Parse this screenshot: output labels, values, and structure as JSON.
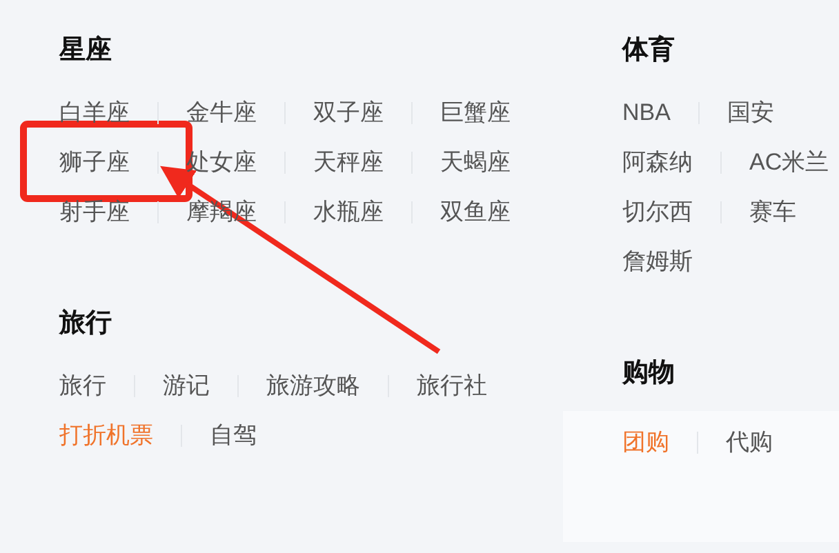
{
  "left_column": [
    {
      "title": "星座",
      "panel": false,
      "rows": [
        [
          {
            "text": "白羊座",
            "highlighted": false
          },
          {
            "text": "金牛座",
            "highlighted": false
          },
          {
            "text": "双子座",
            "highlighted": false
          },
          {
            "text": "巨蟹座",
            "highlighted": false
          }
        ],
        [
          {
            "text": "狮子座",
            "highlighted": false
          },
          {
            "text": "处女座",
            "highlighted": false
          },
          {
            "text": "天秤座",
            "highlighted": false
          },
          {
            "text": "天蝎座",
            "highlighted": false
          }
        ],
        [
          {
            "text": "射手座",
            "highlighted": false
          },
          {
            "text": "摩羯座",
            "highlighted": false
          },
          {
            "text": "水瓶座",
            "highlighted": false
          },
          {
            "text": "双鱼座",
            "highlighted": false
          }
        ]
      ]
    },
    {
      "title": "旅行",
      "panel": false,
      "rows": [
        [
          {
            "text": "旅行",
            "highlighted": false
          },
          {
            "text": "游记",
            "highlighted": false
          },
          {
            "text": "旅游攻略",
            "highlighted": false
          },
          {
            "text": "旅行社",
            "highlighted": false
          }
        ],
        [
          {
            "text": "打折机票",
            "highlighted": true
          },
          {
            "text": "自驾",
            "highlighted": false
          }
        ]
      ]
    }
  ],
  "right_column": [
    {
      "title": "体育",
      "panel": false,
      "rows": [
        [
          {
            "text": "NBA",
            "highlighted": false
          },
          {
            "text": "国安",
            "highlighted": false
          }
        ],
        [
          {
            "text": "阿森纳",
            "highlighted": false
          },
          {
            "text": "AC米兰",
            "highlighted": false
          }
        ],
        [
          {
            "text": "切尔西",
            "highlighted": false
          },
          {
            "text": "赛车",
            "highlighted": false
          }
        ],
        [
          {
            "text": "詹姆斯",
            "highlighted": false
          }
        ]
      ]
    },
    {
      "title": "购物",
      "panel": true,
      "rows": [
        [
          {
            "text": "团购",
            "highlighted": true
          },
          {
            "text": "代购",
            "highlighted": false
          }
        ]
      ]
    }
  ]
}
